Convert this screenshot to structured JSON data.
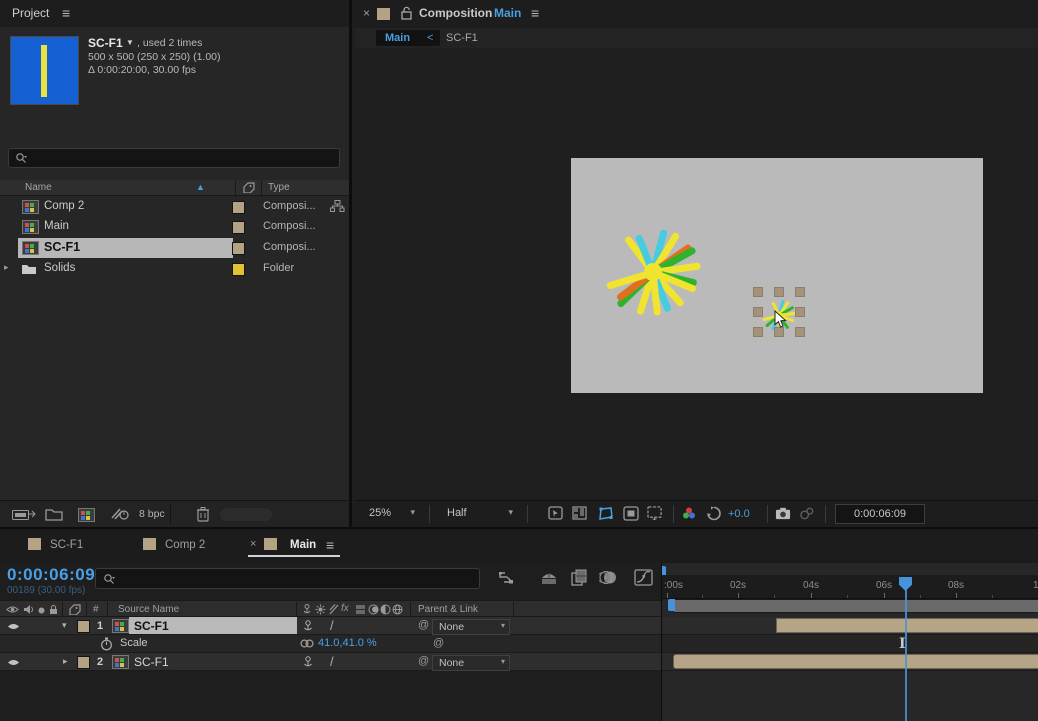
{
  "colors": {
    "accent_blue": "#4aa0e8",
    "label_tan": "#b3a384",
    "label_yellow": "#e2c232",
    "canvas_gray": "#bababa",
    "bar_tan": "#b5a486",
    "thumb_blue": "#1560d2",
    "star_yellow": "#f0e430",
    "star_green": "#2db32c",
    "star_cyan": "#45cce0",
    "star_orange": "#e07020"
  },
  "icons": {
    "menu": "≡",
    "close": "×",
    "caret_small": "▾",
    "sort_asc": "▲",
    "name_caret": "▼",
    "twirl_open": "▾",
    "twirl_closed": "▸",
    "quality": "/",
    "pickwhip": "@",
    "fx": "fx",
    "i_beam": "I"
  },
  "project": {
    "title": "Project",
    "info": {
      "name": "SC-F1",
      "usage": ", used 2 times",
      "dims": "500 x 500  (250 x 250) (1.00)",
      "duration": "Δ 0:00:20:00, 30.00 fps"
    },
    "header": {
      "name": "Name",
      "type": "Type"
    },
    "items": [
      {
        "name": "Comp 2",
        "type": "Composi..."
      },
      {
        "name": "Main",
        "type": "Composi..."
      },
      {
        "name": "SC-F1",
        "type": "Composi..."
      },
      {
        "name": "Solids",
        "type": "Folder"
      }
    ],
    "footer": {
      "bit_depth": "8 bpc"
    }
  },
  "comp": {
    "title": "Composition",
    "comp_name": "Main",
    "breadcrumb": {
      "current": "Main",
      "chevron": "<",
      "previous": "SC-F1"
    },
    "toolbar": {
      "zoom": "25%",
      "resolution": "Half",
      "exposure": "+0.0",
      "timecode": "0:00:06:09"
    }
  },
  "timeline": {
    "tabs": [
      {
        "label": "SC-F1"
      },
      {
        "label": "Comp 2"
      },
      {
        "label": "Main"
      }
    ],
    "timecode": "0:00:06:09",
    "frame_info": "00189 (30.00 fps)",
    "header": {
      "number": "#",
      "source_name": "Source Name",
      "parent_link": "Parent & Link"
    },
    "layers": [
      {
        "number": "1",
        "name": "SC-F1",
        "parent": "None"
      },
      {
        "number": "2",
        "name": "SC-F1",
        "parent": "None"
      }
    ],
    "scale_property": {
      "label": "Scale",
      "value": "41.0,41.0 %"
    },
    "ruler": [
      ":00s",
      "02s",
      "04s",
      "06s",
      "08s",
      "1"
    ]
  }
}
